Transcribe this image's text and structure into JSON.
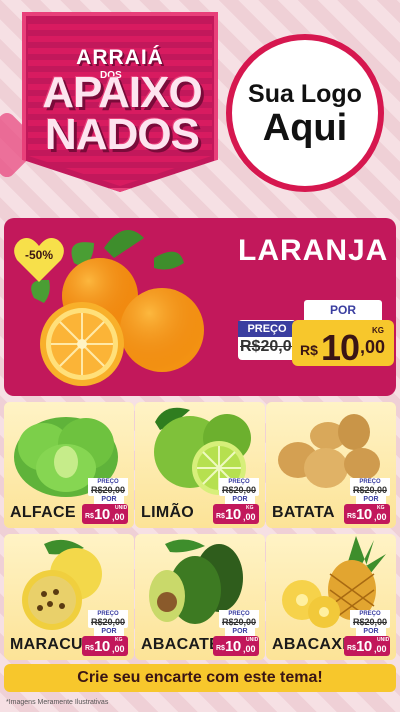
{
  "header": {
    "title_line1": "ARRAIÁ",
    "title_dos": "DOS",
    "title_line2": "APAIXO",
    "title_line3": "NADOS",
    "logo_line1": "Sua Logo",
    "logo_line2": "Aqui"
  },
  "hero": {
    "discount": "-50%",
    "name": "LARANJA",
    "por_label": "POR",
    "preco_label": "PREÇO",
    "old_price": "R$20,00",
    "currency": "R$",
    "price_int": "10",
    "price_dec": ",00",
    "unit": "KG"
  },
  "products": [
    {
      "name": "ALFACE",
      "preco_label": "PREÇO",
      "old_price": "R$20,00",
      "por_label": "POR",
      "currency": "R$",
      "price_int": "10",
      "price_dec": ",00",
      "unit": "UNID"
    },
    {
      "name": "LIMÃO",
      "preco_label": "PREÇO",
      "old_price": "R$20,00",
      "por_label": "POR",
      "currency": "R$",
      "price_int": "10",
      "price_dec": ",00",
      "unit": "KG"
    },
    {
      "name": "BATATA",
      "preco_label": "PREÇO",
      "old_price": "R$20,00",
      "por_label": "POR",
      "currency": "R$",
      "price_int": "10",
      "price_dec": ",00",
      "unit": "KG"
    },
    {
      "name": "MARACUJÁ",
      "preco_label": "PREÇO",
      "old_price": "R$20,00",
      "por_label": "POR",
      "currency": "R$",
      "price_int": "10",
      "price_dec": ",00",
      "unit": "KG"
    },
    {
      "name": "ABACATE",
      "preco_label": "PREÇO",
      "old_price": "R$20,00",
      "por_label": "POR",
      "currency": "R$",
      "price_int": "10",
      "price_dec": ",00",
      "unit": "UNID"
    },
    {
      "name": "ABACAXI",
      "preco_label": "PREÇO",
      "old_price": "R$20,00",
      "por_label": "POR",
      "currency": "R$",
      "price_int": "10",
      "price_dec": ",00",
      "unit": "UNID"
    }
  ],
  "cta": "Crie seu encarte com este tema!",
  "footer_note": "*Imagens Meramente Ilustrativas",
  "colors": {
    "magenta": "#c2185b",
    "yellow": "#f7c72c",
    "navy": "#3a3ea0"
  }
}
